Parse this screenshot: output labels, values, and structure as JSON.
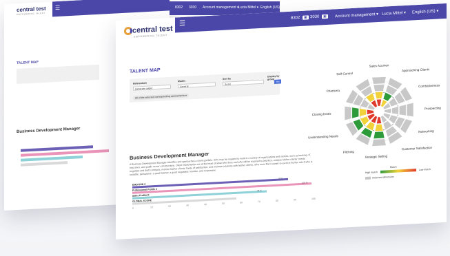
{
  "back": {
    "logo": "central test",
    "logo_sub": "EMPOWERING TALENT",
    "nav_text": [
      "8302",
      "3030",
      "Account management ▾",
      "Lucia Mittel ▾",
      "English (US) ▾"
    ],
    "title": "TALENT MAP",
    "section_title": "Business Development Manager"
  },
  "front": {
    "logo": "central test",
    "logo_sub": "EMPOWERING TALENT",
    "nav": {
      "credits_a": "8302",
      "credits_b": "3030",
      "account": "Account management ▾",
      "user": "Lucia Mittel ▾",
      "language": "English (US) ▾"
    },
    "talent_map_title": "TALENT MAP",
    "filters": {
      "label1": "Referentials",
      "value1": "Generate output",
      "label2": "Modes",
      "value2": "General",
      "label3": "Sort by",
      "value3": "Score",
      "label4": "Display by group",
      "button": "Yes",
      "note": "All of the selected corresponding assessments ▾"
    },
    "section_title": "Business Development Manager",
    "section_text": "A Business Development Manager identifies and approaches a client portfolio. S/he may be required to work in a variety of organizations and sectors, such as banking, IT, insurance, and public sector constructions. Client relationships are at the heart of what s/he does and s/he will be required to prioritize, analyse his/her clients' needs, negotiate and draft contracts, monitor his/her clients' levels of satisfaction, and maintain relations with his/her clients. S/he must find it easier to excel in his/her role if s/he is sociable, persuasive, a good listener, a good negotiator, intuitive, and responsive.",
    "scores": [
      {
        "label": "EMOTION 2",
        "value": 87,
        "value_text": "87.5",
        "color": "#6b5fb6"
      },
      {
        "label": "Professional Profile 2",
        "value": 100,
        "value_text": "100 %",
        "color": "#e994b8"
      },
      {
        "label": "Sales Profile R",
        "value": 75,
        "value_text": "75 %",
        "color": "#8ed1d9"
      },
      {
        "label": "GLOBAL SCORE",
        "value": 58,
        "value_text": "",
        "color": "#d9d9d9"
      }
    ],
    "axis_ticks": [
      "0",
      "10",
      "20",
      "30",
      "40",
      "50",
      "60",
      "70",
      "80",
      "90",
      "100"
    ],
    "radar_labels": [
      "Sales Acumen",
      "Approaching Clients",
      "Combativeness",
      "Prospecting",
      "Networking",
      "Customer Satisfaction",
      "Strategic Selling",
      "Pitching",
      "Understanding Needs",
      "Closing Deals",
      "Charisma",
      "Self-Control"
    ],
    "legend": {
      "title": "Match",
      "high": "High match",
      "low": "Low match",
      "irrelevant": "Irrelevant dimension"
    }
  },
  "colors": {
    "brand": "#4a47a8",
    "green": "#2e9b3a",
    "yellow": "#f2d23a",
    "red": "#e03a2a",
    "grey": "#c8c8c8"
  }
}
